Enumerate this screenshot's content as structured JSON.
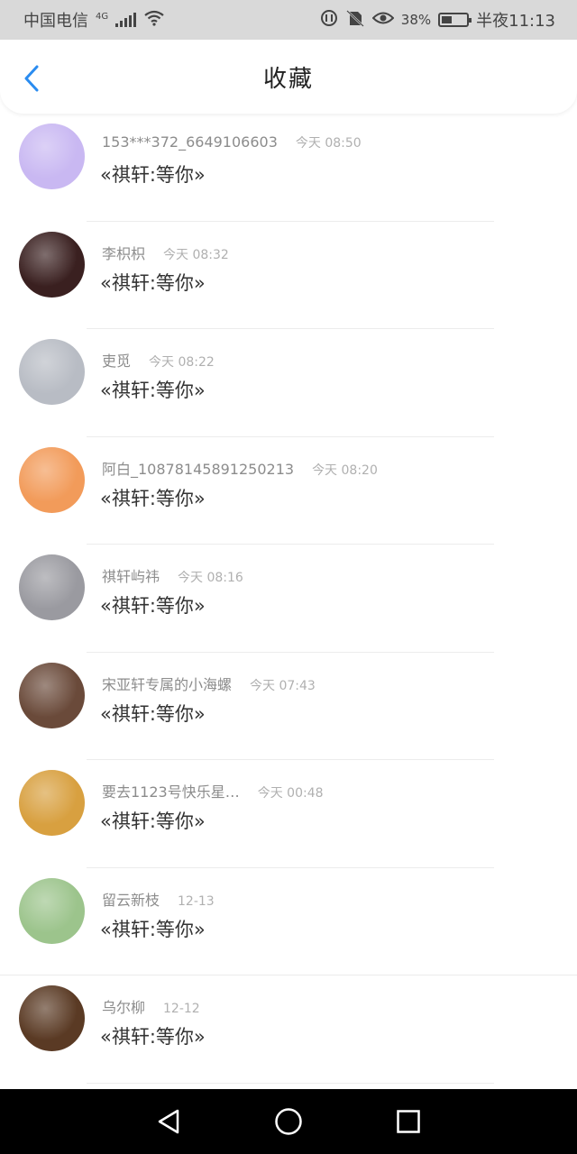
{
  "status_bar": {
    "carrier": "中国电信",
    "network": "4G",
    "battery": "38%",
    "time": "半夜11:13"
  },
  "header": {
    "title": "收藏",
    "back_icon": "chevron-left-icon",
    "accent_color": "#2a8cf0"
  },
  "items": [
    {
      "user": "153***372_6649106603",
      "time": "今天 08:50",
      "content": "«祺轩:等你»",
      "avatar_color": "#c9b8f2"
    },
    {
      "user": "李枳枳",
      "time": "今天 08:32",
      "content": "«祺轩:等你»",
      "avatar_color": "#3a2020"
    },
    {
      "user": "吏觅",
      "time": "今天 08:22",
      "content": "«祺轩:等你»",
      "avatar_color": "#b8bcc4"
    },
    {
      "user": "阿白_10878145891250213",
      "time": "今天 08:20",
      "content": "«祺轩:等你»",
      "avatar_color": "#f29b5a"
    },
    {
      "user": "祺轩屿祎",
      "time": "今天 08:16",
      "content": "«祺轩:等你»",
      "avatar_color": "#9a9aa0"
    },
    {
      "user": "宋亚轩专属的小海螺",
      "time": "今天 07:43",
      "content": "«祺轩:等你»",
      "avatar_color": "#6a4a3a"
    },
    {
      "user": "要去1123号快乐星…",
      "time": "今天 00:48",
      "content": "«祺轩:等你»",
      "avatar_color": "#d8a040"
    },
    {
      "user": "留云新枝",
      "time": "12-13",
      "content": "«祺轩:等你»",
      "avatar_color": "#9cc48c"
    },
    {
      "user": "乌尔柳",
      "time": "12-12",
      "content": "«祺轩:等你»",
      "avatar_color": "#5a3a24"
    }
  ],
  "system_nav": {
    "back": "back-triangle-icon",
    "home": "home-circle-icon",
    "recents": "recents-square-icon"
  }
}
